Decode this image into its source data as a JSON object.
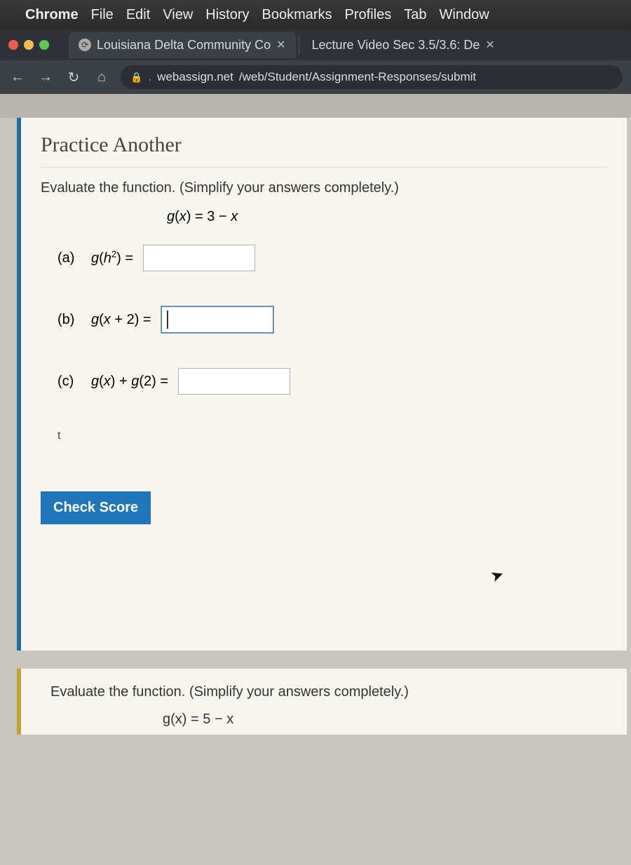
{
  "menubar": {
    "app": "Chrome",
    "items": [
      "File",
      "Edit",
      "View",
      "History",
      "Bookmarks",
      "Profiles",
      "Tab",
      "Window"
    ]
  },
  "tabs": [
    {
      "title": "Louisiana Delta Community Co",
      "active": true
    },
    {
      "title": "Lecture Video Sec 3.5/3.6: De",
      "active": false
    }
  ],
  "url": {
    "lock": true,
    "host_prefix": ". ",
    "host": "webassign.net",
    "path": "/web/Student/Assignment-Responses/submit"
  },
  "question1": {
    "header": "Practice Another",
    "instruction": "Evaluate the function. (Simplify your answers completely.)",
    "func_g": "g",
    "func_var": "x",
    "func_eq": " = 3 − ",
    "parts": {
      "a": {
        "label": "(a)",
        "expr_pre": "g(h",
        "expr_sup": "2",
        "expr_post": ") =",
        "value": ""
      },
      "b": {
        "label": "(b)",
        "expr": "g(x + 2) =",
        "value": ""
      },
      "c": {
        "label": "(c)",
        "expr": "g(x) + g(2) =",
        "value": ""
      }
    },
    "stray": "t",
    "button": "Check Score"
  },
  "question2": {
    "instruction": "Evaluate the function. (Simplify your answers completely.)",
    "func_g": "g",
    "func_var": "x",
    "func_eq": " = 5 − "
  }
}
